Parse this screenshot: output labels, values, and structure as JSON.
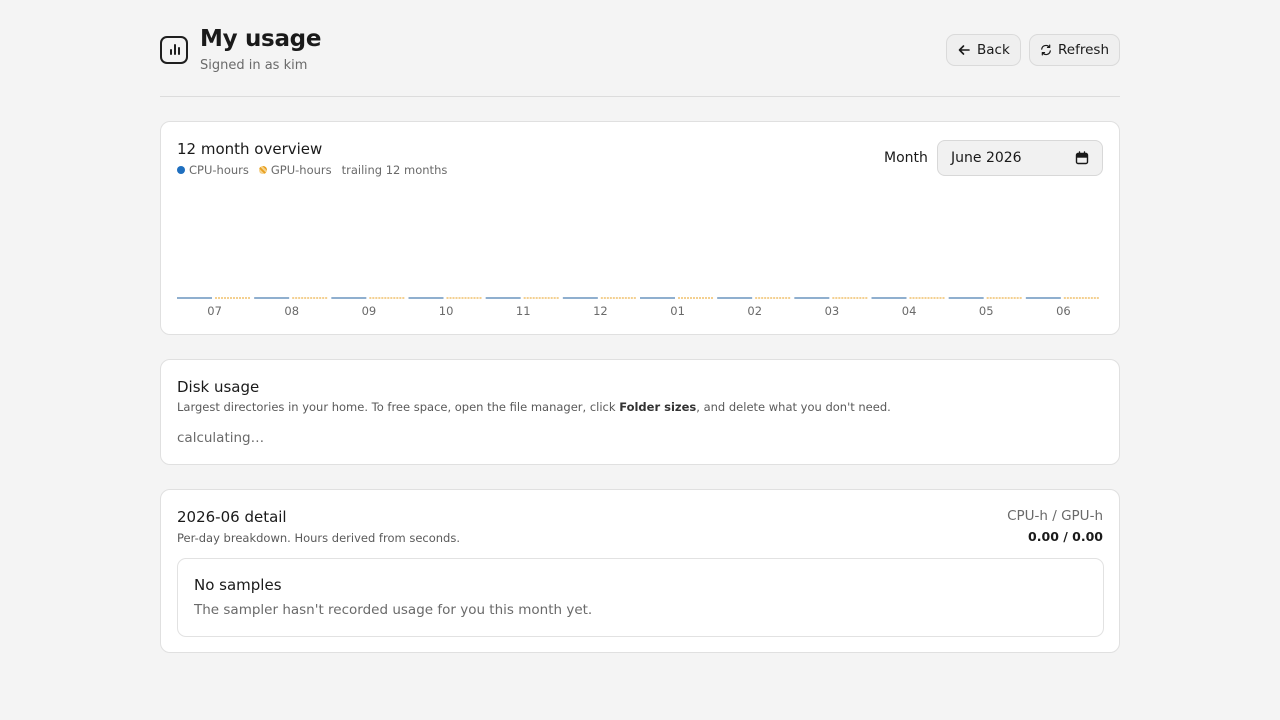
{
  "header": {
    "title": "My usage",
    "subtitle": "Signed in as kim",
    "app_icon": "bar-chart-icon",
    "back_label": "Back",
    "refresh_label": "Refresh"
  },
  "overview": {
    "title": "12 month overview",
    "legend": {
      "cpu_label": "CPU-hours",
      "gpu_label": "GPU-hours",
      "note": "trailing 12 months"
    },
    "month_label": "Month",
    "month_value": "June 2026"
  },
  "chart_data": {
    "type": "bar",
    "categories": [
      "07",
      "08",
      "09",
      "10",
      "11",
      "12",
      "01",
      "02",
      "03",
      "04",
      "05",
      "06"
    ],
    "series": [
      {
        "name": "CPU-hours",
        "values": [
          0,
          0,
          0,
          0,
          0,
          0,
          0,
          0,
          0,
          0,
          0,
          0
        ],
        "color": "#1f6fbf"
      },
      {
        "name": "GPU-hours",
        "values": [
          0,
          0,
          0,
          0,
          0,
          0,
          0,
          0,
          0,
          0,
          0,
          0
        ],
        "color": "#e8a020"
      }
    ],
    "grid": false,
    "legend": "top-left"
  },
  "disk": {
    "title": "Disk usage",
    "desc_before": "Largest directories in your home. To free space, open the file manager, click ",
    "desc_bold": "Folder sizes",
    "desc_after": ", and delete what you don't need.",
    "status": "calculating…"
  },
  "detail": {
    "title": "2026-06 detail",
    "desc": "Per-day breakdown. Hours derived from seconds.",
    "meta_label": "CPU-h / GPU-h",
    "meta_value": "0.00 / 0.00",
    "empty_title": "No samples",
    "empty_text": "The sampler hasn't recorded usage for you this month yet."
  },
  "colors": {
    "cpu": "#1f6fbf",
    "gpu": "#e8a020",
    "background": "#f4f4f4"
  }
}
